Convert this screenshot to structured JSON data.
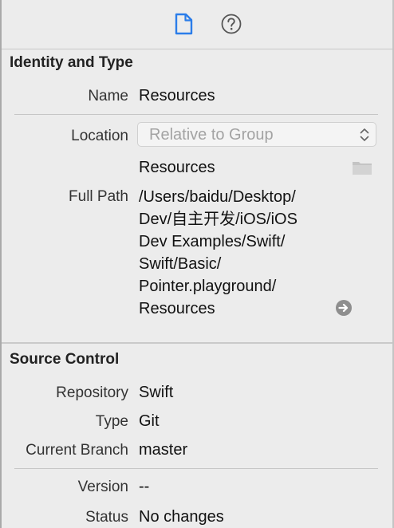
{
  "toolbar": {
    "icons": [
      "file-inspector-icon",
      "quick-help-icon"
    ],
    "accent_color": "#2b7de9"
  },
  "identity": {
    "section_title": "Identity and Type",
    "name_label": "Name",
    "name_value": "Resources",
    "location_label": "Location",
    "location_value": "Relative to Group",
    "location_file": "Resources",
    "full_path_label": "Full Path",
    "full_path_lines": [
      "/Users/baidu/Desktop/",
      "Dev/自主开发/iOS/iOS",
      "Dev Examples/Swift/",
      "Swift/Basic/",
      "Pointer.playground/",
      "Resources"
    ]
  },
  "source_control": {
    "section_title": "Source Control",
    "repository_label": "Repository",
    "repository_value": "Swift",
    "type_label": "Type",
    "type_value": "Git",
    "branch_label": "Current Branch",
    "branch_value": "master",
    "version_label": "Version",
    "version_value": "--",
    "status_label": "Status",
    "status_value": "No changes"
  }
}
